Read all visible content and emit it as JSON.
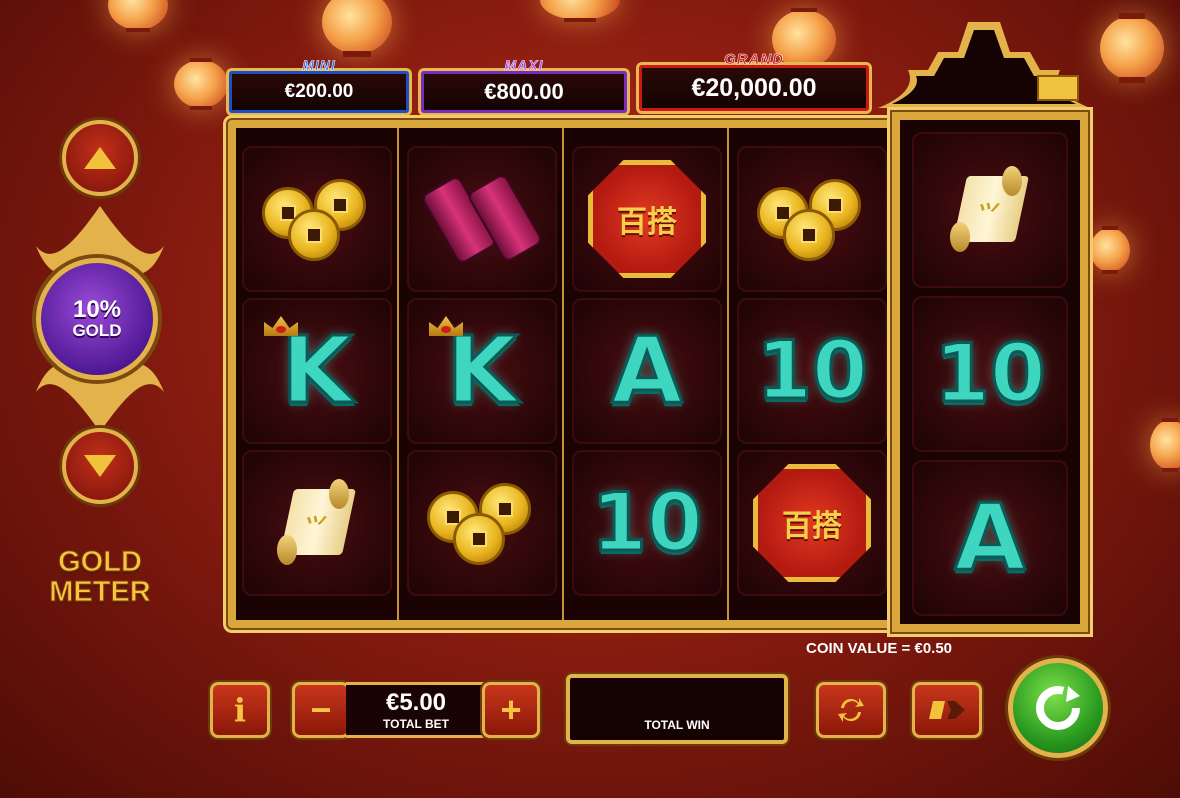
{
  "jackpots": {
    "mini": {
      "label": "MINI",
      "value": "€200.00"
    },
    "maxi": {
      "label": "MAXI",
      "value": "€800.00"
    },
    "grand": {
      "label": "GRAND",
      "value": "€20,000.00"
    }
  },
  "gold_meter": {
    "percent": "10%",
    "label": "GOLD",
    "title_line1": "GOLD",
    "title_line2": "METER"
  },
  "reels": {
    "reel1": [
      "coins",
      "K",
      "scroll"
    ],
    "reel2": [
      "firecracker",
      "K",
      "coins"
    ],
    "reel3": [
      "badge",
      "A",
      "10"
    ],
    "reel4": [
      "coins",
      "10",
      "badge"
    ],
    "reel5": [
      "scroll",
      "10",
      "A"
    ]
  },
  "symbol_text": {
    "K": "K",
    "A": "A",
    "ten": "10",
    "badge": "百搭"
  },
  "bottom_bar": {
    "coin_value": "COIN VALUE = €0.50",
    "info_label": "i",
    "minus_label": "−",
    "plus_label": "+",
    "total_bet_value": "€5.00",
    "total_bet_label": "TOTAL BET",
    "total_win_label": "TOTAL WIN",
    "total_win_value": ""
  },
  "colors": {
    "gold": "#e4b24a",
    "letter_teal": "#3fd6c0",
    "mini_blue": "#1b4fc6",
    "maxi_purple": "#7a2bc4",
    "grand_red": "#c81818",
    "spin_green": "#2a9a20"
  },
  "icons": {
    "up": "triangle-up",
    "down": "triangle-down",
    "refresh": "autoplay-arrows",
    "turbo": "fast-forward-bars",
    "spin": "circular-arrow"
  }
}
